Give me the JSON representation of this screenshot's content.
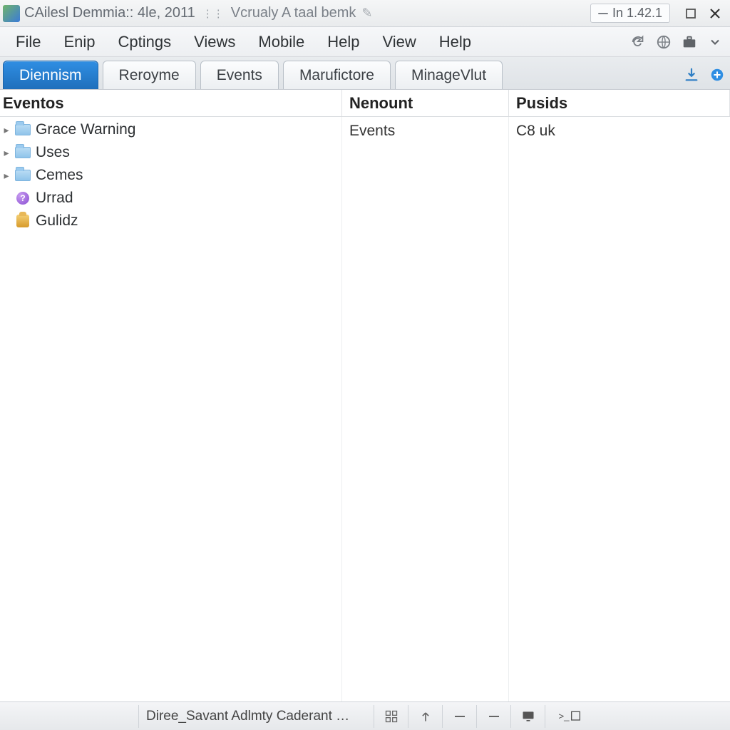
{
  "titlebar": {
    "title_main": "CAilesl Demmia:: 4le, 2011",
    "title_secondary": "Vcrualy A taal bemk",
    "version_label": "In 1.42.1"
  },
  "menu": {
    "items": [
      "File",
      "Enip",
      "Cptings",
      "Views",
      "Mobile",
      "Help",
      "View",
      "Help"
    ]
  },
  "tabs": {
    "items": [
      {
        "label": "Diennism",
        "active": true
      },
      {
        "label": "Reroyme",
        "active": false
      },
      {
        "label": "Events",
        "active": false
      },
      {
        "label": "Marufictore",
        "active": false
      },
      {
        "label": "MinageVlut",
        "active": false
      }
    ]
  },
  "columns": {
    "c1": "Eventos",
    "c2": "Nenount",
    "c3": "Pusids"
  },
  "tree": {
    "nodes": [
      {
        "label": "Grace Warning",
        "icon": "folder",
        "expandable": true
      },
      {
        "label": "Uses",
        "icon": "folder",
        "expandable": true
      },
      {
        "label": "Cemes",
        "icon": "folder",
        "expandable": true
      },
      {
        "label": "Urrad",
        "icon": "purple",
        "expandable": false
      },
      {
        "label": "Gulidz",
        "icon": "gold",
        "expandable": false
      }
    ]
  },
  "list": {
    "rows": [
      {
        "nenount": "Events",
        "pusids": "C8 uk"
      }
    ]
  },
  "statusbar": {
    "doc_text": "Diree_Savant Adlmty Caderant …"
  }
}
